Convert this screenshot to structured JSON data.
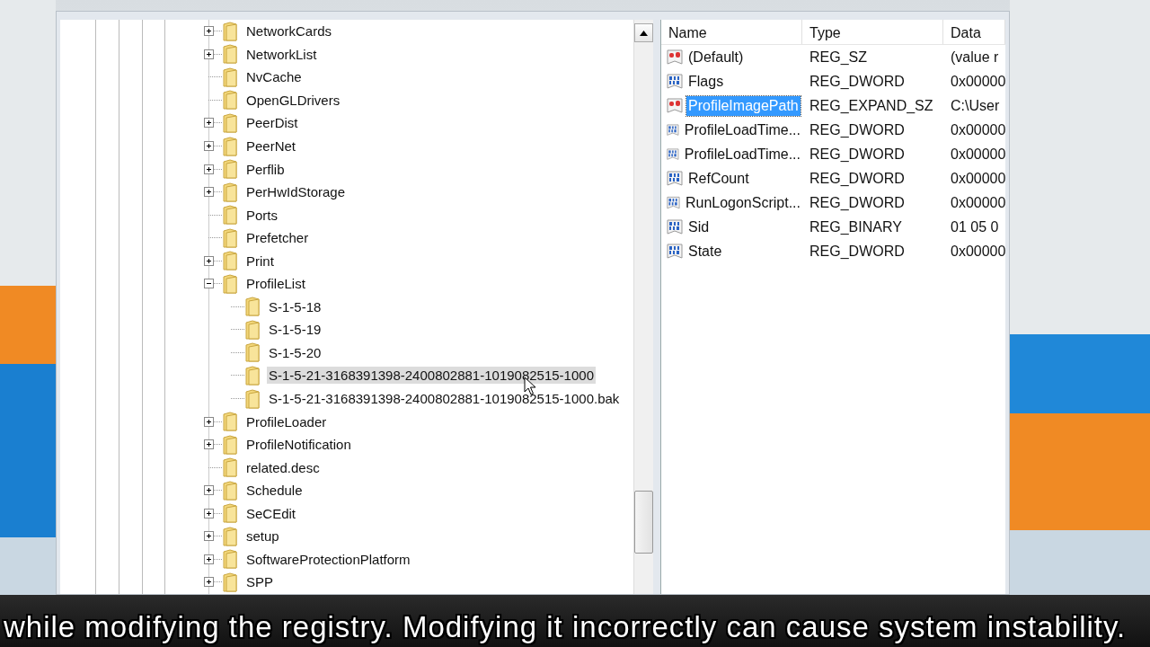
{
  "tree": {
    "items": [
      {
        "name": "NetworkCards",
        "kind": "branch",
        "expanded": false,
        "selected": false
      },
      {
        "name": "NetworkList",
        "kind": "branch",
        "expanded": false,
        "selected": false
      },
      {
        "name": "NvCache",
        "kind": "leaf",
        "expanded": false,
        "selected": false
      },
      {
        "name": "OpenGLDrivers",
        "kind": "leaf",
        "expanded": false,
        "selected": false
      },
      {
        "name": "PeerDist",
        "kind": "branch",
        "expanded": false,
        "selected": false
      },
      {
        "name": "PeerNet",
        "kind": "branch",
        "expanded": false,
        "selected": false
      },
      {
        "name": "Perflib",
        "kind": "branch",
        "expanded": false,
        "selected": false
      },
      {
        "name": "PerHwIdStorage",
        "kind": "branch",
        "expanded": false,
        "selected": false
      },
      {
        "name": "Ports",
        "kind": "leaf",
        "expanded": false,
        "selected": false
      },
      {
        "name": "Prefetcher",
        "kind": "leaf",
        "expanded": false,
        "selected": false
      },
      {
        "name": "Print",
        "kind": "branch",
        "expanded": false,
        "selected": false
      },
      {
        "name": "ProfileList",
        "kind": "branch",
        "expanded": true,
        "selected": false,
        "children": [
          {
            "name": "S-1-5-18",
            "kind": "leaf",
            "expanded": false,
            "selected": false
          },
          {
            "name": "S-1-5-19",
            "kind": "leaf",
            "expanded": false,
            "selected": false
          },
          {
            "name": "S-1-5-20",
            "kind": "leaf",
            "expanded": false,
            "selected": false
          },
          {
            "name": "S-1-5-21-3168391398-2400802881-1019082515-1000",
            "kind": "leaf",
            "expanded": false,
            "selected": true
          },
          {
            "name": "S-1-5-21-3168391398-2400802881-1019082515-1000.bak",
            "kind": "leaf",
            "expanded": false,
            "selected": false
          }
        ]
      },
      {
        "name": "ProfileLoader",
        "kind": "branch",
        "expanded": false,
        "selected": false
      },
      {
        "name": "ProfileNotification",
        "kind": "branch",
        "expanded": false,
        "selected": false
      },
      {
        "name": "related.desc",
        "kind": "leaf",
        "expanded": false,
        "selected": false
      },
      {
        "name": "Schedule",
        "kind": "branch",
        "expanded": false,
        "selected": false
      },
      {
        "name": "SeCEdit",
        "kind": "branch",
        "expanded": false,
        "selected": false
      },
      {
        "name": "setup",
        "kind": "branch",
        "expanded": false,
        "selected": false
      },
      {
        "name": "SoftwareProtectionPlatform",
        "kind": "branch",
        "expanded": false,
        "selected": false
      },
      {
        "name": "SPP",
        "kind": "branch",
        "expanded": false,
        "selected": false
      }
    ]
  },
  "values": {
    "columns": [
      "Name",
      "Type",
      "Data"
    ],
    "rows": [
      {
        "name": "(Default)",
        "type": "REG_SZ",
        "data": "(value r",
        "kind": "string",
        "selected": false
      },
      {
        "name": "Flags",
        "type": "REG_DWORD",
        "data": "0x00000",
        "kind": "binary",
        "selected": false
      },
      {
        "name": "ProfileImagePath",
        "type": "REG_EXPAND_SZ",
        "data": "C:\\User",
        "kind": "string",
        "selected": true
      },
      {
        "name": "ProfileLoadTime...",
        "type": "REG_DWORD",
        "data": "0x00000",
        "kind": "binary",
        "selected": false
      },
      {
        "name": "ProfileLoadTime...",
        "type": "REG_DWORD",
        "data": "0x00000",
        "kind": "binary",
        "selected": false
      },
      {
        "name": "RefCount",
        "type": "REG_DWORD",
        "data": "0x00000",
        "kind": "binary",
        "selected": false
      },
      {
        "name": "RunLogonScript...",
        "type": "REG_DWORD",
        "data": "0x00000",
        "kind": "binary",
        "selected": false
      },
      {
        "name": "Sid",
        "type": "REG_BINARY",
        "data": "01 05 0",
        "kind": "binary",
        "selected": false
      },
      {
        "name": "State",
        "type": "REG_DWORD",
        "data": "0x00000",
        "kind": "binary",
        "selected": false
      }
    ]
  },
  "caption": "while modifying the registry. Modifying it incorrectly can cause system instability."
}
